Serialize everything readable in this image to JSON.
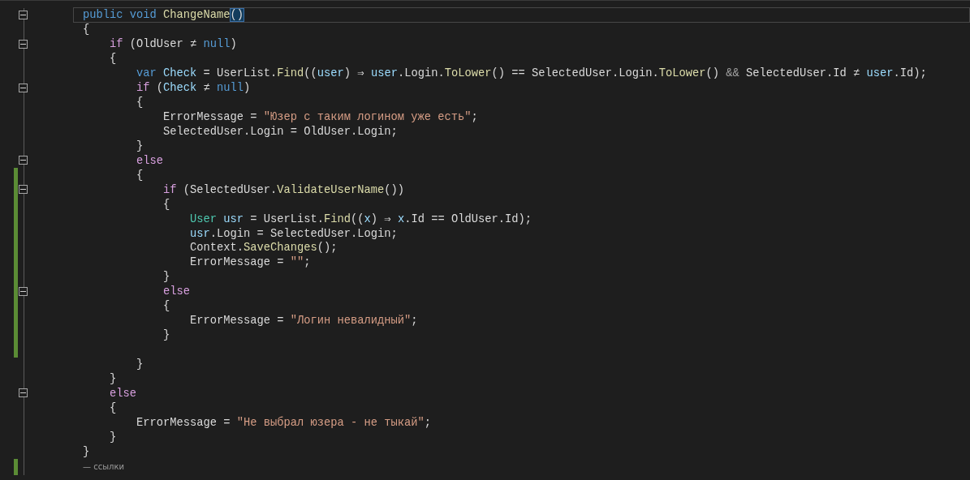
{
  "editor": {
    "lines": [
      {
        "kind": "code",
        "foldable": true,
        "changed": false,
        "current": true,
        "tokens": [
          {
            "kind": "keyword",
            "text": "public void "
          },
          {
            "kind": "method",
            "text": "ChangeName"
          },
          {
            "kind": "match",
            "text": "()"
          }
        ]
      },
      {
        "kind": "code",
        "foldable": false,
        "changed": false,
        "current": false,
        "tokens": [
          {
            "kind": "plain",
            "text": "{"
          }
        ],
        "children": [
          {
            "kind": "code",
            "foldable": true,
            "changed": false,
            "current": false,
            "tokens": [
              {
                "kind": "control",
                "text": "if"
              },
              {
                "kind": "plain",
                "text": " (OldUser ≠ "
              },
              {
                "kind": "keyword",
                "text": "null"
              },
              {
                "kind": "plain",
                "text": ")"
              }
            ]
          },
          {
            "kind": "code",
            "foldable": false,
            "changed": false,
            "current": false,
            "tokens": [
              {
                "kind": "plain",
                "text": "{"
              }
            ],
            "children": [
              {
                "kind": "code",
                "foldable": false,
                "changed": false,
                "current": false,
                "tokens": [
                  {
                    "kind": "keyword",
                    "text": "var "
                  },
                  {
                    "kind": "local",
                    "text": "Check"
                  },
                  {
                    "kind": "plain",
                    "text": " = UserList."
                  },
                  {
                    "kind": "method",
                    "text": "Find"
                  },
                  {
                    "kind": "plain",
                    "text": "(("
                  },
                  {
                    "kind": "local",
                    "text": "user"
                  },
                  {
                    "kind": "plain",
                    "text": ") ⇒ "
                  },
                  {
                    "kind": "local",
                    "text": "user"
                  },
                  {
                    "kind": "plain",
                    "text": ".Login."
                  },
                  {
                    "kind": "method",
                    "text": "ToLower"
                  },
                  {
                    "kind": "plain",
                    "text": "() == SelectedUser.Login."
                  },
                  {
                    "kind": "method",
                    "text": "ToLower"
                  },
                  {
                    "kind": "plain",
                    "text": "() "
                  },
                  {
                    "kind": "dim",
                    "text": "&&"
                  },
                  {
                    "kind": "plain",
                    "text": " SelectedUser.Id ≠ "
                  },
                  {
                    "kind": "local",
                    "text": "user"
                  },
                  {
                    "kind": "plain",
                    "text": ".Id);"
                  }
                ]
              },
              {
                "kind": "code",
                "foldable": true,
                "changed": false,
                "current": false,
                "tokens": [
                  {
                    "kind": "control",
                    "text": "if"
                  },
                  {
                    "kind": "plain",
                    "text": " ("
                  },
                  {
                    "kind": "local",
                    "text": "Check"
                  },
                  {
                    "kind": "plain",
                    "text": " ≠ "
                  },
                  {
                    "kind": "keyword",
                    "text": "null"
                  },
                  {
                    "kind": "plain",
                    "text": ")"
                  }
                ]
              },
              {
                "kind": "code",
                "foldable": false,
                "changed": false,
                "current": false,
                "tokens": [
                  {
                    "kind": "plain",
                    "text": "{"
                  }
                ],
                "children": [
                  {
                    "kind": "code",
                    "foldable": false,
                    "changed": false,
                    "current": false,
                    "tokens": [
                      {
                        "kind": "plain",
                        "text": "ErrorMessage = "
                      },
                      {
                        "kind": "string",
                        "text": "\"Юзер с таким логином уже есть\""
                      },
                      {
                        "kind": "plain",
                        "text": ";"
                      }
                    ]
                  },
                  {
                    "kind": "code",
                    "foldable": false,
                    "changed": false,
                    "current": false,
                    "tokens": [
                      {
                        "kind": "plain",
                        "text": "SelectedUser.Login = OldUser.Login;"
                      }
                    ]
                  }
                ]
              },
              {
                "kind": "code",
                "foldable": false,
                "changed": false,
                "current": false,
                "tokens": [
                  {
                    "kind": "plain",
                    "text": "}"
                  }
                ]
              },
              {
                "kind": "code",
                "foldable": true,
                "changed": false,
                "current": false,
                "tokens": [
                  {
                    "kind": "control",
                    "text": "else"
                  }
                ]
              },
              {
                "kind": "code",
                "foldable": false,
                "changed": true,
                "current": false,
                "tokens": [
                  {
                    "kind": "plain",
                    "text": "{"
                  }
                ],
                "children": [
                  {
                    "kind": "code",
                    "foldable": true,
                    "changed": true,
                    "current": false,
                    "tokens": [
                      {
                        "kind": "control",
                        "text": "if"
                      },
                      {
                        "kind": "plain",
                        "text": " (SelectedUser."
                      },
                      {
                        "kind": "method",
                        "text": "ValidateUserName"
                      },
                      {
                        "kind": "plain",
                        "text": "())"
                      }
                    ]
                  },
                  {
                    "kind": "code",
                    "foldable": false,
                    "changed": true,
                    "current": false,
                    "tokens": [
                      {
                        "kind": "plain",
                        "text": "{"
                      }
                    ],
                    "children": [
                      {
                        "kind": "code",
                        "foldable": false,
                        "changed": true,
                        "current": false,
                        "tokens": [
                          {
                            "kind": "type",
                            "text": "User "
                          },
                          {
                            "kind": "local",
                            "text": "usr"
                          },
                          {
                            "kind": "plain",
                            "text": " = UserList."
                          },
                          {
                            "kind": "method",
                            "text": "Find"
                          },
                          {
                            "kind": "plain",
                            "text": "(("
                          },
                          {
                            "kind": "local",
                            "text": "x"
                          },
                          {
                            "kind": "plain",
                            "text": ") ⇒ "
                          },
                          {
                            "kind": "local",
                            "text": "x"
                          },
                          {
                            "kind": "plain",
                            "text": ".Id == OldUser.Id);"
                          }
                        ]
                      },
                      {
                        "kind": "code",
                        "foldable": false,
                        "changed": true,
                        "current": false,
                        "tokens": [
                          {
                            "kind": "local",
                            "text": "usr"
                          },
                          {
                            "kind": "plain",
                            "text": ".Login = SelectedUser.Login;"
                          }
                        ]
                      },
                      {
                        "kind": "code",
                        "foldable": false,
                        "changed": true,
                        "current": false,
                        "tokens": [
                          {
                            "kind": "plain",
                            "text": "Context."
                          },
                          {
                            "kind": "method",
                            "text": "SaveChanges"
                          },
                          {
                            "kind": "plain",
                            "text": "();"
                          }
                        ]
                      },
                      {
                        "kind": "code",
                        "foldable": false,
                        "changed": true,
                        "current": false,
                        "tokens": [
                          {
                            "kind": "plain",
                            "text": "ErrorMessage = "
                          },
                          {
                            "kind": "string",
                            "text": "\"\""
                          },
                          {
                            "kind": "plain",
                            "text": ";"
                          }
                        ]
                      }
                    ]
                  },
                  {
                    "kind": "code",
                    "foldable": false,
                    "changed": true,
                    "current": false,
                    "tokens": [
                      {
                        "kind": "plain",
                        "text": "}"
                      }
                    ]
                  },
                  {
                    "kind": "code",
                    "foldable": true,
                    "changed": true,
                    "current": false,
                    "tokens": [
                      {
                        "kind": "control",
                        "text": "else"
                      }
                    ]
                  },
                  {
                    "kind": "code",
                    "foldable": false,
                    "changed": true,
                    "current": false,
                    "tokens": [
                      {
                        "kind": "plain",
                        "text": "{"
                      }
                    ],
                    "children": [
                      {
                        "kind": "code",
                        "foldable": false,
                        "changed": true,
                        "current": false,
                        "tokens": [
                          {
                            "kind": "plain",
                            "text": "ErrorMessage = "
                          },
                          {
                            "kind": "string",
                            "text": "\"Логин невалидный\""
                          },
                          {
                            "kind": "plain",
                            "text": ";"
                          }
                        ]
                      }
                    ]
                  },
                  {
                    "kind": "code",
                    "foldable": false,
                    "changed": true,
                    "current": false,
                    "tokens": [
                      {
                        "kind": "plain",
                        "text": "}"
                      }
                    ]
                  },
                  {
                    "kind": "code",
                    "foldable": false,
                    "changed": true,
                    "current": false
                  }
                ]
              },
              {
                "kind": "code",
                "foldable": false,
                "changed": false,
                "current": false,
                "tokens": [
                  {
                    "kind": "plain",
                    "text": "}"
                  }
                ]
              }
            ]
          },
          {
            "kind": "code",
            "foldable": false,
            "changed": false,
            "current": false,
            "tokens": [
              {
                "kind": "plain",
                "text": "}"
              }
            ]
          },
          {
            "kind": "code",
            "foldable": true,
            "changed": false,
            "current": false,
            "tokens": [
              {
                "kind": "control",
                "text": "else"
              }
            ]
          },
          {
            "kind": "code",
            "foldable": false,
            "changed": false,
            "current": false,
            "tokens": [
              {
                "kind": "plain",
                "text": "{"
              }
            ],
            "children": [
              {
                "kind": "code",
                "foldable": false,
                "changed": false,
                "current": false,
                "tokens": [
                  {
                    "kind": "plain",
                    "text": "ErrorMessage = "
                  },
                  {
                    "kind": "string",
                    "text": "\"Не выбрал юзера - не тыкай\""
                  },
                  {
                    "kind": "plain",
                    "text": ";"
                  }
                ]
              }
            ]
          },
          {
            "kind": "code",
            "foldable": false,
            "changed": false,
            "current": false,
            "tokens": [
              {
                "kind": "plain",
                "text": "}"
              }
            ]
          }
        ]
      },
      {
        "kind": "code",
        "foldable": false,
        "changed": false,
        "current": false,
        "tokens": [
          {
            "kind": "plain",
            "text": "}"
          }
        ]
      },
      {
        "kind": "codelens",
        "foldable": false,
        "changed": true,
        "current": false,
        "text": "— ссылки"
      }
    ]
  }
}
